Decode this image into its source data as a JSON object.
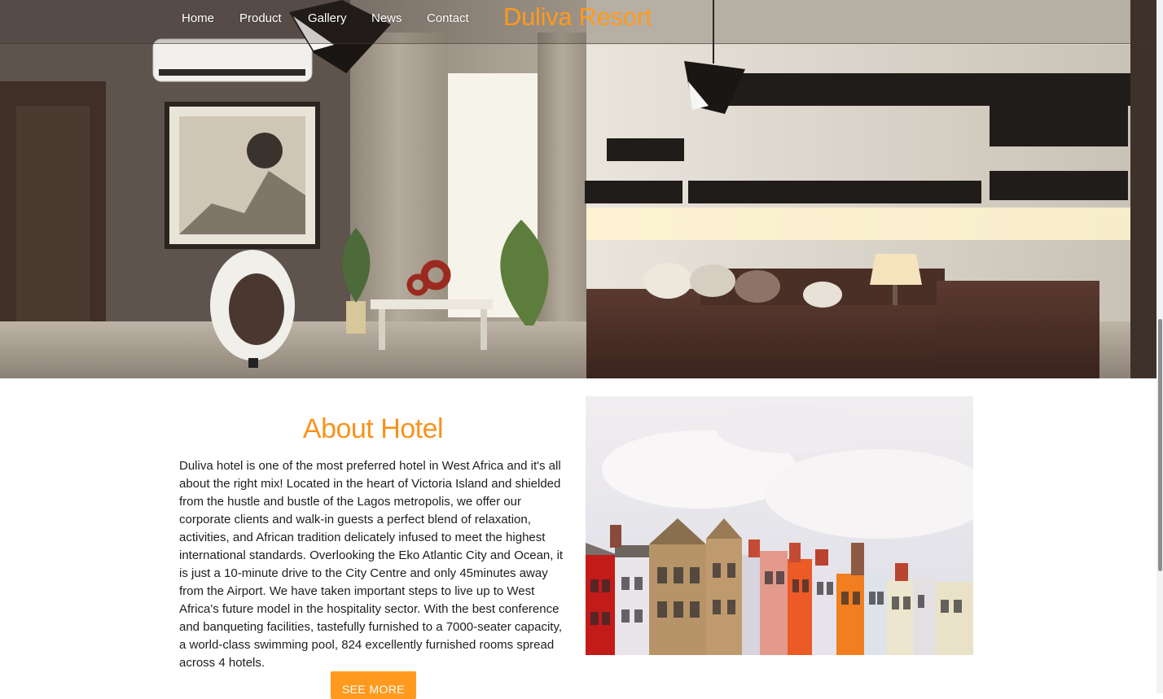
{
  "nav": {
    "items": [
      {
        "label": "Home"
      },
      {
        "label": "Product"
      },
      {
        "label": "Gallery"
      },
      {
        "label": "News"
      },
      {
        "label": "Contact"
      }
    ],
    "brand": "Duliva Resort"
  },
  "about": {
    "title": "About Hotel",
    "text": "Duliva hotel is one of the most preferred hotel in West Africa and it's all about the right mix! Located in the heart of Victoria Island and shielded from the hustle and bustle of the Lagos metropolis, we offer our corporate clients and walk-in guests a perfect blend of relaxation, activities, and African tradition delicately infused to meet the highest international standards. Overlooking the Eko Atlantic City and Ocean, it is just a 10-minute drive to the City Centre and only 45minutes away from the Airport. We have taken important steps to live up to West Africa's future model in the hospitality sector. With the best conference and banqueting facilities, tastefully furnished to a 7000-seater capacity, a world-class swimming pool, 824 excellently furnished rooms spread across 4 hotels.",
    "button": "SEE MORE"
  },
  "colors": {
    "accent": "#f7931e",
    "button": "#ff9a1f"
  }
}
